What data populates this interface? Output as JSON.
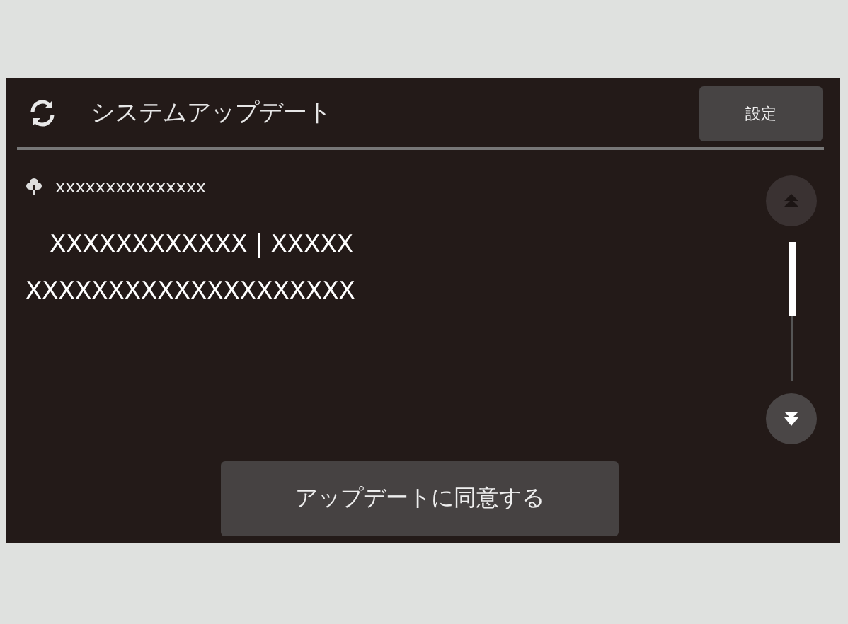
{
  "header": {
    "title": "システムアップデート",
    "settings_button": "設定"
  },
  "content": {
    "download_line": "xxxxxxxxxxxxxxx",
    "lines": [
      "XXXXXXXXXXXX | XXXXX",
      "XXXXXXXXXXXXXXXXXXXX"
    ]
  },
  "scroll": {
    "up_disabled": true,
    "down_disabled": false
  },
  "agree_button": "アップデートに同意する"
}
